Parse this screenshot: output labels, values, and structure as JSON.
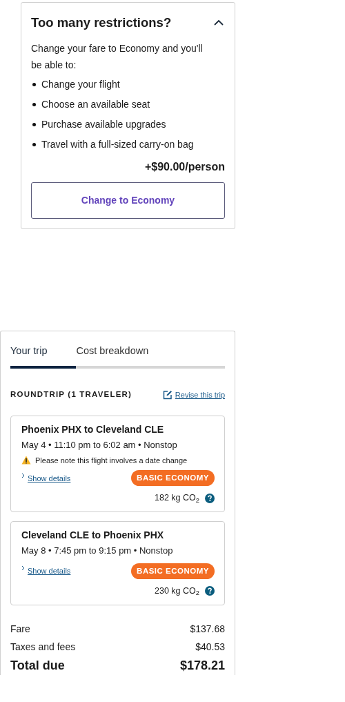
{
  "upsell": {
    "title": "Too many restrictions?",
    "expanded": true,
    "intro": "Change your fare to Economy and you'll be able to:",
    "benefits": [
      "Change your flight",
      "Choose an available seat",
      "Purchase available upgrades",
      "Travel with a full-sized carry-on bag"
    ],
    "price": "+$90.00/person",
    "button": "Change to Economy"
  },
  "summary": {
    "tabs": [
      {
        "label": "Your trip",
        "selected": true
      },
      {
        "label": "Cost breakdown",
        "selected": false
      }
    ],
    "heading": "ROUNDTRIP (1 TRAVELER)",
    "revise_link": "Revise this trip",
    "flights": [
      {
        "route": "Phoenix PHX to Cleveland CLE",
        "times": "May 4 • 11:10 pm to 6:02 am • Nonstop",
        "warning": "Please note this flight involves a date change",
        "details_link": "Show details",
        "fare_badge": "BASIC ECONOMY",
        "emissions": "182 kg CO$_{2}$"
      },
      {
        "route": "Cleveland CLE to Phoenix PHX",
        "times": "May 8 • 7:45 pm to 9:15 pm • Nonstop",
        "details_link": "Show details",
        "fare_badge": "BASIC ECONOMY",
        "emissions": "230 kg CO$_{2}$"
      }
    ],
    "costs": [
      {
        "kind": "line",
        "label": "Fare",
        "amount": "$137.68"
      },
      {
        "kind": "line",
        "label": "Taxes and fees",
        "amount": "$40.53"
      },
      {
        "kind": "total",
        "label": "Total due",
        "amount": "$178.21"
      }
    ]
  }
}
